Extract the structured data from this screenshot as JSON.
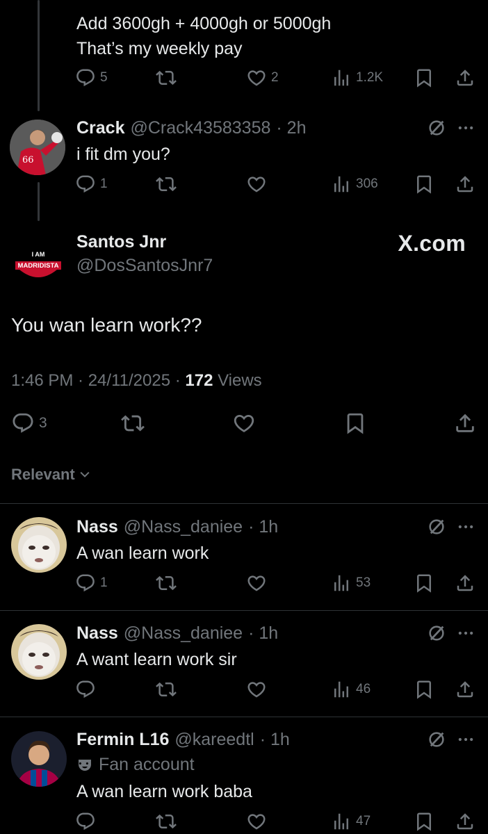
{
  "tweet0": {
    "text_line1": "Add 3600gh + 4000gh or 5000gh",
    "text_line2": "That’s my weekly pay",
    "replies": "5",
    "reposts": "",
    "likes": "2",
    "views": "1.2K"
  },
  "tweet1": {
    "name": "Crack",
    "handle": "@Crack43583358",
    "time": "· 2h",
    "text": "i fit dm you?",
    "replies": "1",
    "views": "306",
    "avatar_jersey": "66"
  },
  "main": {
    "name": "Santos Jnr",
    "handle": "@DosSantosJnr7",
    "avatar_top": "I AM",
    "avatar_mid": "MADRIDISTA",
    "text": "You wan learn work??",
    "timestamp": "1:46 PM · 24/11/2025 ·",
    "views_count": "172",
    "views_label": "Views",
    "replies": "3",
    "watermark": "X.com"
  },
  "sort": {
    "label": "Relevant"
  },
  "replies": [
    {
      "name": "Nass",
      "handle": "@Nass_daniee",
      "time": "· 1h",
      "text": "A wan learn work",
      "replies": "1",
      "views": "53"
    },
    {
      "name": "Nass",
      "handle": "@Nass_daniee",
      "time": "· 1h",
      "text": "A want learn work sir",
      "replies": "",
      "views": "46"
    },
    {
      "name": "Fermin L16",
      "handle": "@kareedtl",
      "time": "· 1h",
      "badge": "Fan account",
      "text": "A wan learn work baba",
      "replies": "",
      "views": "47"
    }
  ],
  "colors": {
    "background": "#000000",
    "text": "#e7e9ea",
    "muted": "#71767b",
    "divider": "#2f3336"
  }
}
